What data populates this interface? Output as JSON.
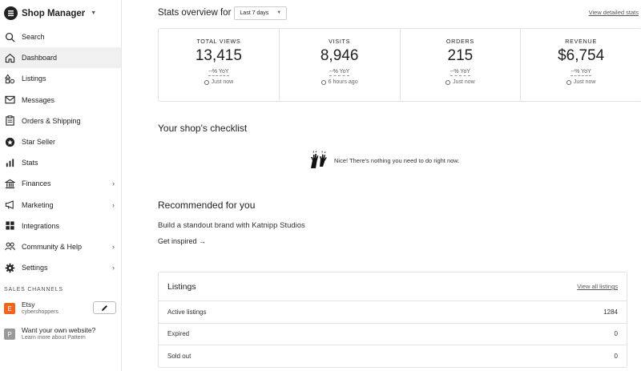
{
  "app": {
    "title": "Shop Manager"
  },
  "nav": [
    {
      "label": "Search",
      "icon": "search-icon"
    },
    {
      "label": "Dashboard",
      "icon": "home-icon"
    },
    {
      "label": "Listings",
      "icon": "listings-icon"
    },
    {
      "label": "Messages",
      "icon": "mail-icon"
    },
    {
      "label": "Orders & Shipping",
      "icon": "clipboard-icon"
    },
    {
      "label": "Star Seller",
      "icon": "star-badge-icon"
    },
    {
      "label": "Stats",
      "icon": "bar-chart-icon"
    },
    {
      "label": "Finances",
      "icon": "bank-icon"
    },
    {
      "label": "Marketing",
      "icon": "megaphone-icon"
    },
    {
      "label": "Integrations",
      "icon": "grid-icon"
    },
    {
      "label": "Community & Help",
      "icon": "people-icon"
    },
    {
      "label": "Settings",
      "icon": "gear-icon"
    }
  ],
  "sales_channels": {
    "header": "SALES CHANNELS",
    "etsy": {
      "badge": "E",
      "name": "Etsy",
      "sub": "cybershoppers",
      "color": "#f1641e"
    },
    "pattern": {
      "badge": "P",
      "name": "Want your own website?",
      "sub": "Learn more about Pattern",
      "color": "#9a9a9a"
    }
  },
  "stats": {
    "title": "Stats overview for",
    "period": "Last 7 days",
    "view_link": "View detailed stats",
    "items": [
      {
        "label": "TOTAL VIEWS",
        "value": "13,415",
        "yoy": "--% YoY",
        "time": "Just now"
      },
      {
        "label": "VISITS",
        "value": "8,946",
        "yoy": "--% YoY",
        "time": "6 hours ago"
      },
      {
        "label": "ORDERS",
        "value": "215",
        "yoy": "--% YoY",
        "time": "Just now"
      },
      {
        "label": "REVENUE",
        "value": "$6,754",
        "yoy": "--% YoY",
        "time": "Just now"
      }
    ]
  },
  "checklist": {
    "title": "Your shop's checklist",
    "message": "Nice! There's nothing you need to do right now."
  },
  "recommended": {
    "title": "Recommended for you",
    "subtitle": "Build a standout brand with Katnipp Studios",
    "link": "Get inspired →"
  },
  "listings": {
    "title": "Listings",
    "view_link": "View all listings",
    "rows": [
      {
        "label": "Active listings",
        "value": "1284"
      },
      {
        "label": "Expired",
        "value": "0"
      },
      {
        "label": "Sold out",
        "value": "0"
      }
    ]
  }
}
